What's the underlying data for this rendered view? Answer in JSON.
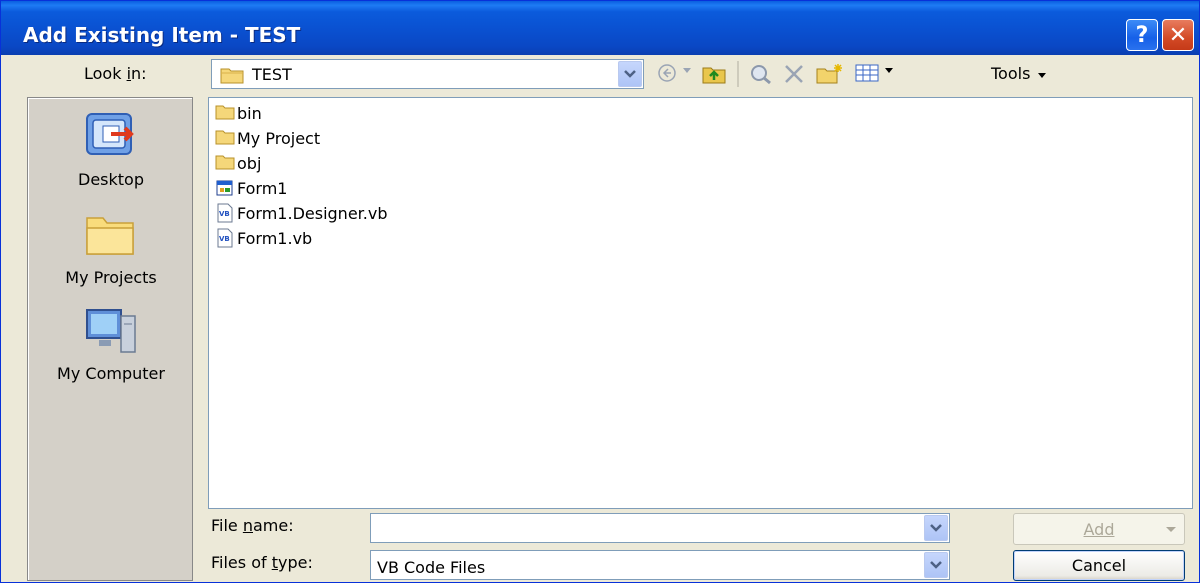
{
  "window": {
    "title": "Add Existing Item - TEST",
    "help_glyph": "?",
    "close_glyph": "✕"
  },
  "look_in": {
    "label": "Look in:",
    "value": "TEST"
  },
  "toolbar": {
    "icons": [
      "back-icon",
      "up-folder-icon",
      "search-web-icon",
      "delete-icon",
      "new-folder-icon",
      "views-icon"
    ],
    "tools_label": "Tools"
  },
  "places": [
    {
      "label": "Desktop",
      "icon": "desktop-icon"
    },
    {
      "label": "My Projects",
      "icon": "folder-icon"
    },
    {
      "label": "My Computer",
      "icon": "computer-icon"
    }
  ],
  "files": [
    {
      "name": "bin",
      "icon": "folder-icon"
    },
    {
      "name": "My Project",
      "icon": "folder-icon"
    },
    {
      "name": "obj",
      "icon": "folder-icon"
    },
    {
      "name": "Form1",
      "icon": "form-icon"
    },
    {
      "name": "Form1.Designer.vb",
      "icon": "vb-file-icon"
    },
    {
      "name": "Form1.vb",
      "icon": "vb-file-icon"
    }
  ],
  "file_name": {
    "label": "File name:",
    "value": ""
  },
  "file_type": {
    "label": "Files of type:",
    "value": "VB Code Files"
  },
  "buttons": {
    "add": "Add",
    "cancel": "Cancel"
  },
  "colors": {
    "title_bar": "#0a50d0",
    "window_bg": "#ece9d8",
    "close_button": "#d34a26"
  }
}
